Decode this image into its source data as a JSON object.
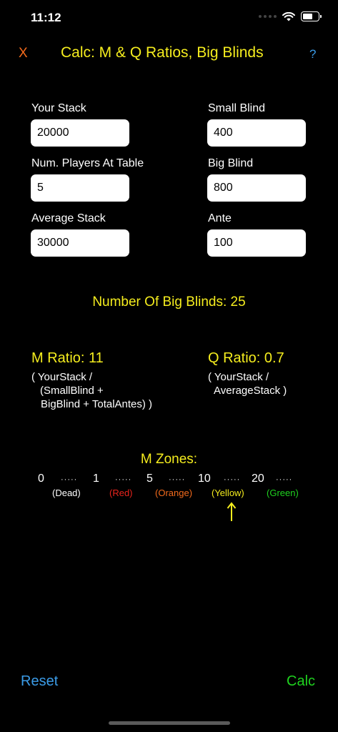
{
  "status_bar": {
    "time": "11:12",
    "icons": [
      "signal-dots-icon",
      "wifi-icon",
      "battery-icon"
    ]
  },
  "nav": {
    "close_label": "X",
    "title": "Calc: M & Q Ratios, Big Blinds",
    "help_label": "?"
  },
  "form": {
    "your_stack": {
      "label": "Your Stack",
      "value": "20000"
    },
    "small_blind": {
      "label": "Small Blind",
      "value": "400"
    },
    "num_players": {
      "label": "Num. Players At Table",
      "value": "5"
    },
    "big_blind": {
      "label": "Big Blind",
      "value": "800"
    },
    "average_stack": {
      "label": "Average Stack",
      "value": "30000"
    },
    "ante": {
      "label": "Ante",
      "value": "100"
    }
  },
  "results": {
    "big_blinds_text": "Number Of Big Blinds:  25",
    "m_ratio": {
      "title": "M Ratio:  11",
      "formula_line1": "( YourStack /",
      "formula_line2": "(SmallBlind +",
      "formula_line3": "BigBlind + TotalAntes) )"
    },
    "q_ratio": {
      "title": "Q Ratio:  0.7",
      "formula_line1": "( YourStack /",
      "formula_line2": "AverageStack )"
    }
  },
  "zones": {
    "title": "M Zones:",
    "numbers": [
      "0",
      "1",
      "5",
      "10",
      "20"
    ],
    "dots": "·····",
    "labels": [
      {
        "text": "(Dead)",
        "color": "#ffffff"
      },
      {
        "text": "(Red)",
        "color": "#e8231c"
      },
      {
        "text": "(Orange)",
        "color": "#f36a1c"
      },
      {
        "text": "(Yellow)",
        "color": "#f5ed1e"
      },
      {
        "text": "(Green)",
        "color": "#1fd21f"
      }
    ],
    "current_zone": "(Yellow)",
    "indicator_icon": "arrow-up-icon"
  },
  "footer": {
    "reset_label": "Reset",
    "calc_label": "Calc"
  },
  "colors": {
    "accent_yellow": "#f5ed1e",
    "link_blue": "#3b9ce8",
    "close_orange": "#f36a1c",
    "calc_green": "#1fd21f"
  }
}
